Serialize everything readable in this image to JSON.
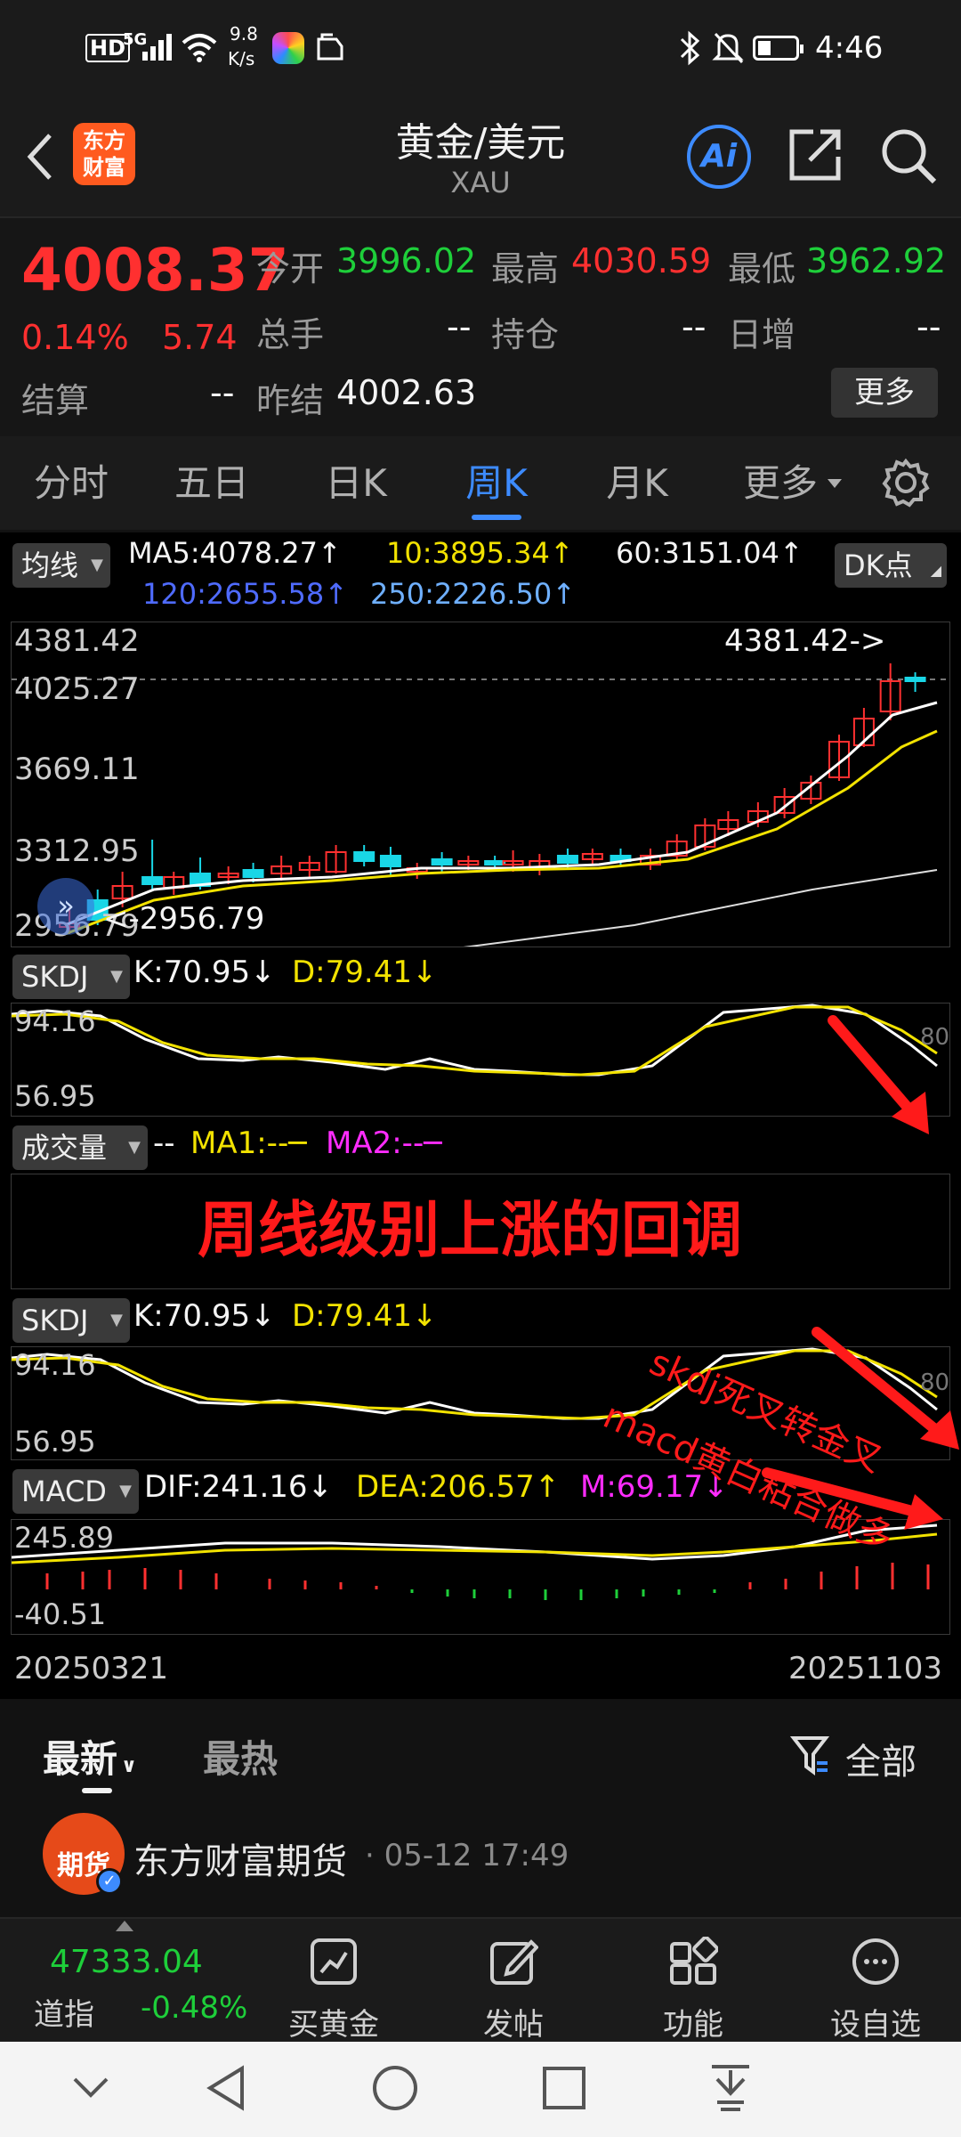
{
  "status_bar": {
    "time": "4:46",
    "net_speed_value": "9.8",
    "net_speed_unit": "K/s",
    "hd": "HD",
    "signal": "5G"
  },
  "header": {
    "logo_line1": "东方",
    "logo_line2": "财富",
    "title": "黄金/美元",
    "subtitle": "XAU",
    "ai_label": "Ai"
  },
  "quote": {
    "price": "4008.37",
    "change_pct": "0.14%",
    "change": "5.74",
    "open_label": "今开",
    "open": "3996.02",
    "high_label": "最高",
    "high": "4030.59",
    "low_label": "最低",
    "low": "3962.92",
    "volume_label": "总手",
    "volume": "--",
    "position_label": "持仓",
    "position": "--",
    "daily_inc_label": "日增",
    "daily_inc": "--",
    "settle_label": "结算",
    "settle": "--",
    "prev_settle_label": "昨结",
    "prev_settle": "4002.63",
    "more_button": "更多"
  },
  "tabs": [
    "分时",
    "五日",
    "日K",
    "周K",
    "月K",
    "更多"
  ],
  "active_tab": "周K",
  "chart": {
    "ma_selector": "均线",
    "ma5": "MA5:4078.27↑",
    "ma10": "10:3895.34↑",
    "ma60": "60:3151.04↑",
    "ma120": "120:2655.58↑",
    "ma250": "250:2226.50↑",
    "dk_button": "DK点",
    "price_axis": [
      "4381.42",
      "4025.27",
      "3669.11",
      "3312.95",
      "2956.79"
    ],
    "high_marker": "4381.42->",
    "low_marker": "<-2956.79",
    "skdj_label": "SKDJ",
    "skdj_k": "K:70.95↓",
    "skdj_d": "D:79.41↓",
    "skdj_axis_top": "94.16",
    "skdj_axis_bottom": "56.95",
    "skdj_right": "80",
    "volume_label": "成交量",
    "volume_value": "--",
    "vol_ma1": "MA1:--─",
    "vol_ma2": "MA2:--─",
    "annotation_main": "周线级别上涨的回调",
    "annotation_skdj": "skdj死叉转金叉",
    "annotation_macd": "macd黄白粘合做多",
    "macd_label": "MACD",
    "macd_dif": "DIF:241.16↓",
    "macd_dea": "DEA:206.57↑",
    "macd_m": "M:69.17↓",
    "macd_axis_top": "245.89",
    "macd_axis_bottom": "-40.51",
    "date_start": "20250321",
    "date_end": "20251103"
  },
  "news": {
    "tab_latest": "最新",
    "tab_hot": "最热",
    "filter": "全部",
    "author": "东方财富期货",
    "time": "· 05-12 17:49",
    "avatar_text": "期货"
  },
  "bottom_nav": {
    "index_value": "47333.04",
    "index_name": "道指",
    "index_change": "-0.48%",
    "items": [
      "买黄金",
      "发帖",
      "功能",
      "设自选"
    ]
  },
  "colors": {
    "up": "#ff3030",
    "down": "#1ecf3a",
    "accent": "#3d8bff",
    "candle_down": "#19d6e6",
    "annotation": "#ff1a1a"
  }
}
